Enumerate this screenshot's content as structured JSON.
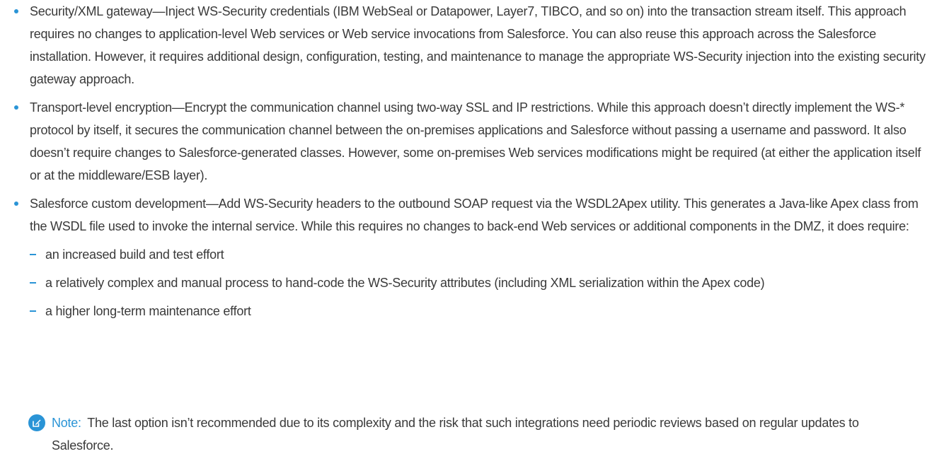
{
  "bullets": [
    "Security/XML gateway—Inject WS-Security credentials (IBM WebSeal or Datapower, Layer7, TIBCO, and so on) into the transaction stream itself. This approach requires no changes to application-level Web services or Web service invocations from Salesforce. You can also reuse this approach across the Salesforce installation. However, it requires additional design, configuration, testing, and maintenance to manage the appropriate WS-Security injection into the existing security gateway approach.",
    "Transport-level encryption—Encrypt the communication channel using two-way SSL and IP restrictions. While this approach doesn’t directly implement the WS-* protocol by itself, it secures the communication channel between the on-premises applications and Salesforce without passing a username and password. It also doesn’t require changes to Salesforce-generated classes. However, some on-premises Web services modifications might be required (at either the application itself or at the middleware/ESB layer).",
    "Salesforce custom development—Add WS-Security headers to the outbound SOAP request via the WSDL2Apex utility. This generates a Java-like Apex class from the WSDL file used to invoke the internal service. While this requires no changes to back-end Web services or additional components in the DMZ, it does require:"
  ],
  "sub_bullets": [
    "an increased build and test effort",
    "a relatively complex and manual process to hand-code the WS-Security attributes (including XML serialization within the Apex code)",
    "a higher long-term maintenance effort"
  ],
  "note": {
    "label": "Note:",
    "text": "The last option isn’t recommended due to its complexity and the risk that such integrations need periodic reviews based on regular updates to Salesforce.",
    "icon": "edit-note-icon"
  },
  "colors": {
    "accent": "#2a94d6",
    "text": "#3a3a3a"
  }
}
